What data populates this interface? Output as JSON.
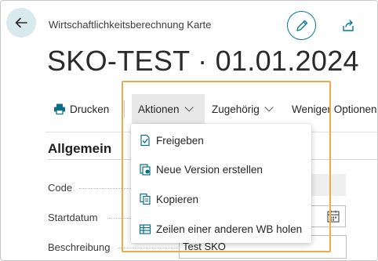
{
  "header": {
    "page_caption": "Wirtschaftlichkeitsberechnung Karte",
    "record_title": "SKO-TEST · 01.01.2024"
  },
  "icons": {
    "back": "arrow-left-icon",
    "edit": "pencil-icon",
    "share": "share-icon",
    "print": "printer-icon",
    "calendar": "calendar-icon"
  },
  "toolbar": {
    "print_label": "Drucken",
    "actions_label": "Aktionen",
    "related_label": "Zugehörig",
    "fewer_options_label": "Weniger Optionen"
  },
  "actions_menu": {
    "items": [
      {
        "label": "Freigeben",
        "icon": "approve-document-icon"
      },
      {
        "label": "Neue Version erstellen",
        "icon": "new-version-icon"
      },
      {
        "label": "Kopieren",
        "icon": "copy-document-icon"
      },
      {
        "label": "Zeilen einer anderen WB holen",
        "icon": "get-lines-icon"
      }
    ]
  },
  "general_section": {
    "title": "Allgemein",
    "fields": [
      {
        "label": "Code",
        "value": ""
      },
      {
        "label": "Startdatum",
        "value": ""
      },
      {
        "label": "Beschreibung",
        "value": "Test SKO"
      }
    ]
  },
  "colors": {
    "accent": "#0a7a8c",
    "back_button_bg": "#d9eaef",
    "highlight_border": "#f0aa4e",
    "selected_tab_bg": "#e8e8e8"
  }
}
